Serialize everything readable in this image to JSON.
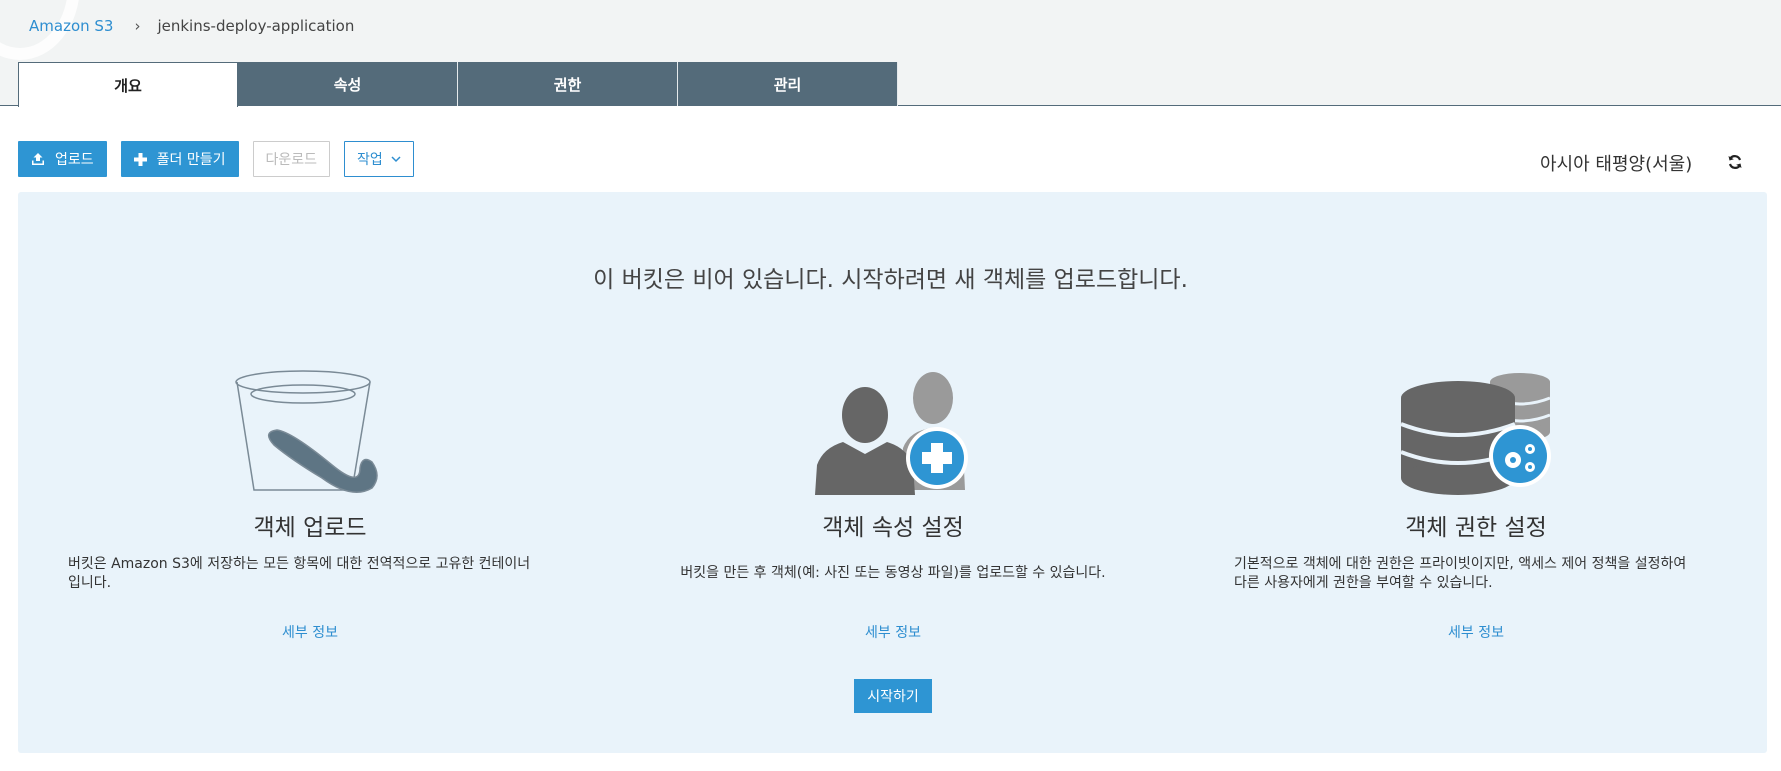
{
  "breadcrumb": {
    "root": "Amazon S3",
    "separator": "›",
    "current": "jenkins-deploy-application"
  },
  "tabs": [
    {
      "label": "개요",
      "active": true
    },
    {
      "label": "속성",
      "active": false
    },
    {
      "label": "권한",
      "active": false
    },
    {
      "label": "관리",
      "active": false
    }
  ],
  "toolbar": {
    "upload_label": "업로드",
    "create_folder_label": "폴더 만들기",
    "download_label": "다운로드",
    "actions_label": "작업"
  },
  "region": "아시아 태평양(서울)",
  "empty_state": {
    "headline": "이 버킷은 비어 있습니다. 시작하려면 새 객체를 업로드합니다.",
    "features": [
      {
        "icon": "bucket-icon",
        "title": "객체 업로드",
        "description_line1": "버킷은 Amazon S3에 저장하는 모든 항목에 대한 전역적으로 고유한 컨테이너",
        "description_line2": "입니다.",
        "link": "세부 정보"
      },
      {
        "icon": "users-add-icon",
        "title": "객체 속성 설정",
        "description_line1": "버킷을 만든 후 객체(예: 사진 또는 동영상 파일)를 업로드할 수 있습니다.",
        "description_line2": "",
        "link": "세부 정보"
      },
      {
        "icon": "database-settings-icon",
        "title": "객체 권한 설정",
        "description_line1": "기본적으로 객체에 대한 권한은 프라이빗이지만, 액세스 제어 정책을 설정하여",
        "description_line2": "다른 사용자에게 권한을 부여할 수 있습니다.",
        "link": "세부 정보"
      }
    ],
    "start_button": "시작하기"
  },
  "colors": {
    "accent": "#2e95d3",
    "tab_bg": "#546b7a",
    "panel_bg": "#e9f3fa",
    "icon_gray": "#666666"
  }
}
